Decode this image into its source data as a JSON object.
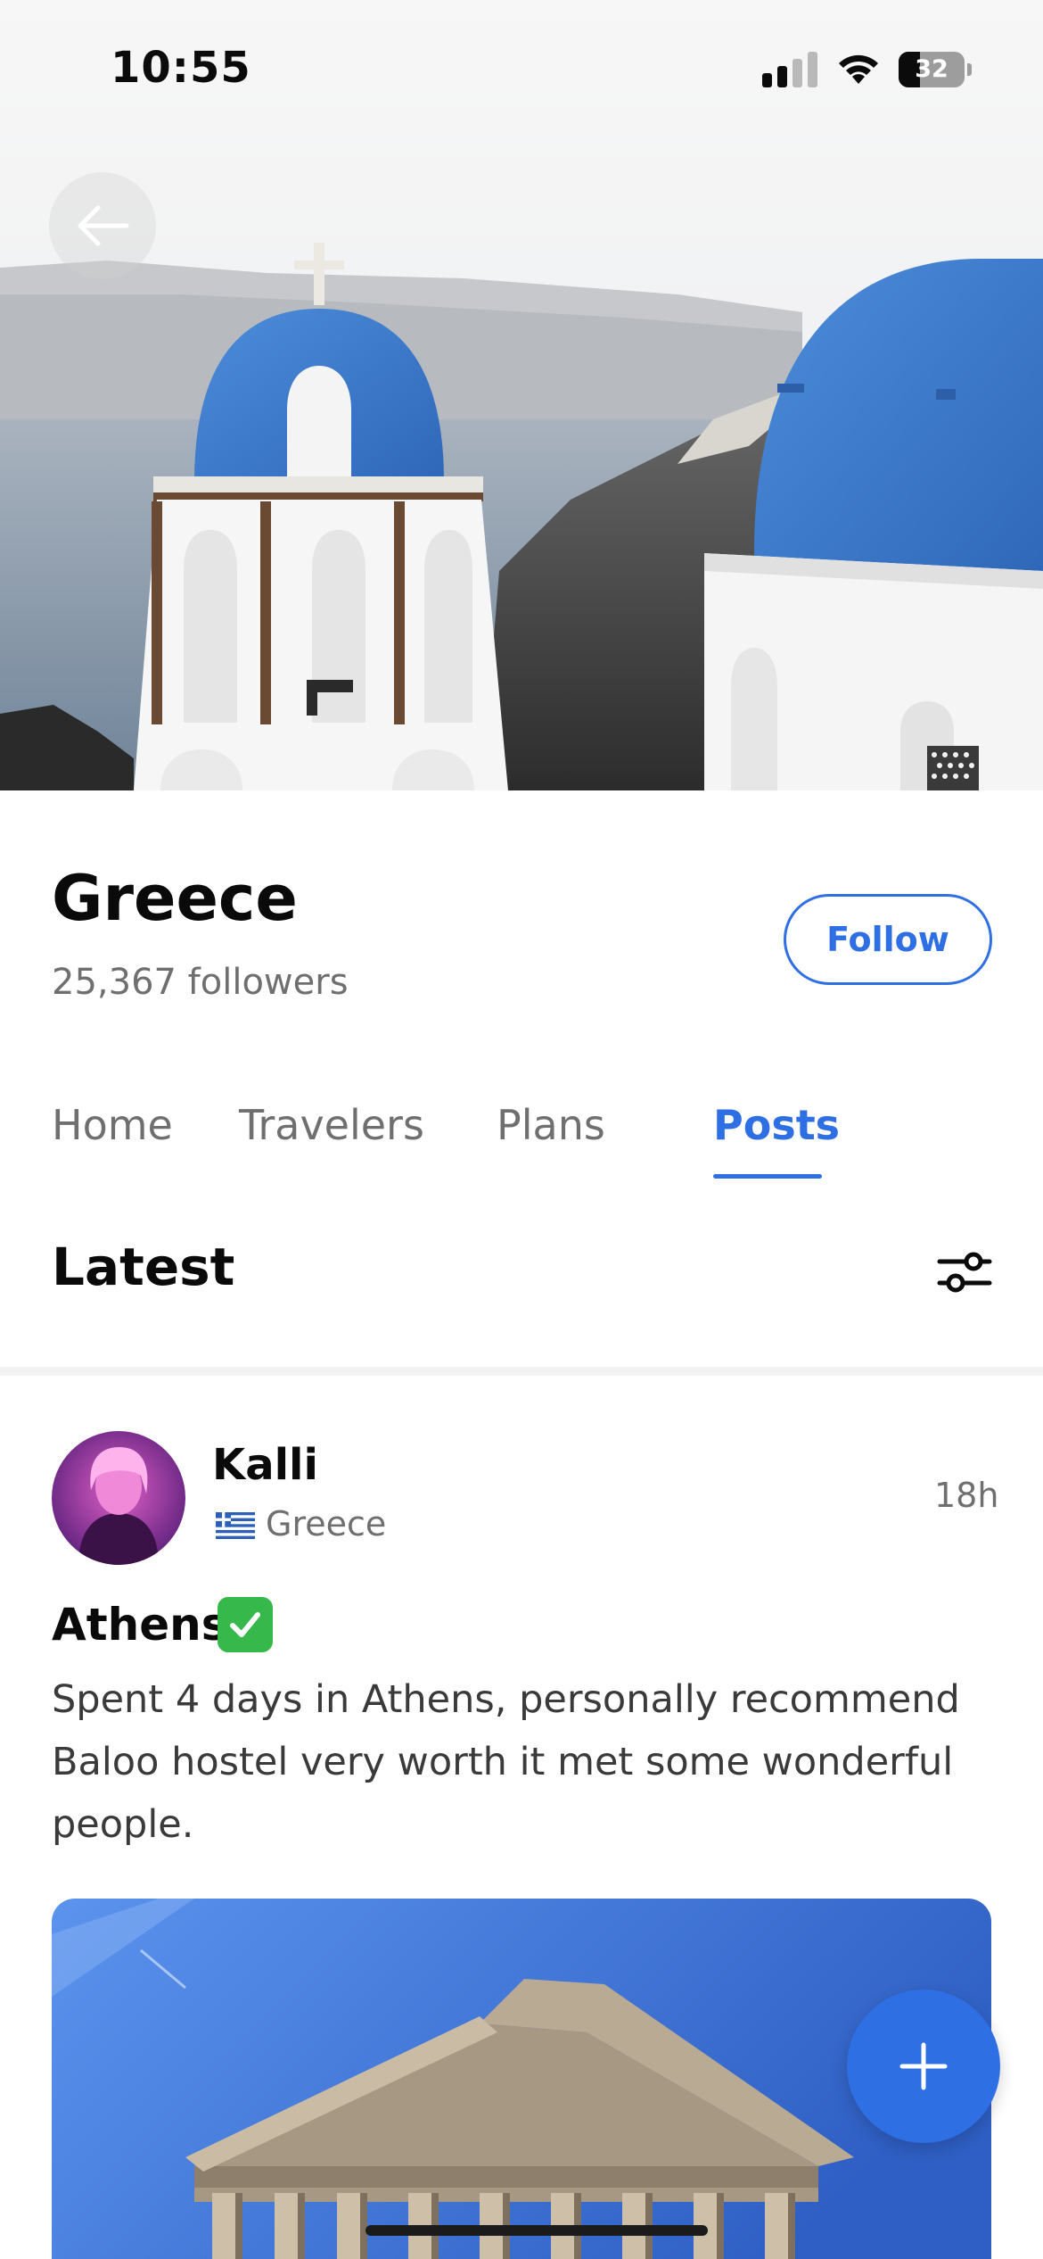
{
  "status_bar": {
    "time": "10:55",
    "battery_level": "32",
    "battery_fraction": 0.32,
    "icons": [
      "signal-icon",
      "wifi-icon",
      "battery-icon"
    ]
  },
  "hero": {
    "image": "santorini-blue-domes-photo",
    "back_icon": "arrow-left-icon"
  },
  "group": {
    "title": "Greece",
    "followers": "25,367 followers",
    "follow_label": "Follow"
  },
  "tabs": [
    {
      "label": "Home",
      "active": false
    },
    {
      "label": "Travelers",
      "active": false
    },
    {
      "label": "Plans",
      "active": false
    },
    {
      "label": "Posts",
      "active": true
    }
  ],
  "section": {
    "title": "Latest",
    "filter_icon": "sliders-icon"
  },
  "post": {
    "author": "Kalli",
    "location_flag": "greece-flag-icon",
    "location": "Greece",
    "time": "18h",
    "title": "Athens",
    "title_icon": "check-mark-button-icon",
    "body": "Spent 4 days in Athens, personally recommend Baloo hostel very worth it met some wonderful people.",
    "image": "parthenon-photo"
  },
  "fab": {
    "icon": "plus-icon"
  },
  "colors": {
    "accent": "#2f6fe4",
    "text_primary": "#0a0a0a",
    "text_secondary": "#6f6f6f",
    "dome_blue": "#3f7fd0",
    "check_green": "#37b84a"
  }
}
